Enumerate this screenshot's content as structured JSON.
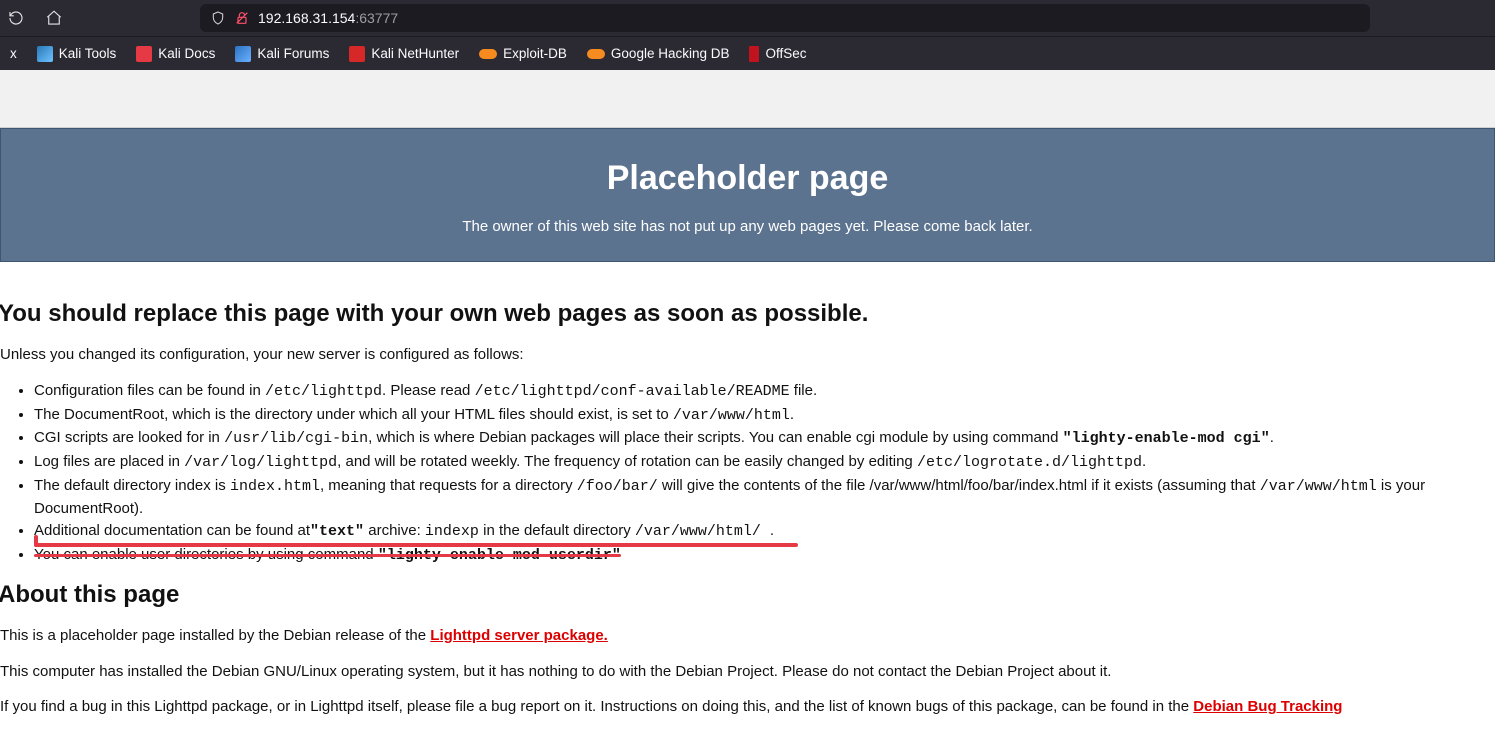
{
  "browser": {
    "url_host": "192.168.31.154",
    "url_port": ":63777"
  },
  "bookmarks": {
    "kx": "x",
    "kali_tools": "Kali Tools",
    "kali_docs": "Kali Docs",
    "kali_forums": "Kali Forums",
    "kali_nethunter": "Kali NetHunter",
    "exploit_db": "Exploit-DB",
    "ghd": "Google Hacking DB",
    "offsec": "OffSec"
  },
  "hero": {
    "title": "Placeholder page",
    "subtitle": "The owner of this web site has not put up any web pages yet. Please come back later."
  },
  "content": {
    "h2_replace": "You should replace this page with your own web pages as soon as possible.",
    "intro": "Unless you changed its configuration, your new server is configured as follows:",
    "li1_a": "Configuration files can be found in ",
    "li1_tt1": "/etc/lighttpd",
    "li1_b": ". Please read ",
    "li1_tt2": "/etc/lighttpd/conf-available/README",
    "li1_c": " file.",
    "li2_a": "The DocumentRoot, which is the directory under which all your HTML files should exist, is set to ",
    "li2_tt": "/var/www/html",
    "li2_b": ".",
    "li3_a": "CGI scripts are looked for in ",
    "li3_tt": "/usr/lib/cgi-bin",
    "li3_b": ", which is where Debian packages will place their scripts. You can enable cgi module by using command ",
    "li3_tt2": "\"lighty-enable-mod cgi\"",
    "li3_c": ".",
    "li4_a": "Log files are placed in ",
    "li4_tt": "/var/log/lighttpd",
    "li4_b": ", and will be rotated weekly. The frequency of rotation can be easily changed by editing ",
    "li4_tt2": "/etc/logrotate.d/lighttpd",
    "li4_c": ".",
    "li5_a": "The default directory index is ",
    "li5_tt1": "index.html",
    "li5_b": ", meaning that requests for a directory ",
    "li5_tt2": "/foo/bar/",
    "li5_c": " will give the contents of the file /var/www/html/foo/bar/index.html if it exists (assuming that ",
    "li5_tt3": "/var/www/html",
    "li5_d": " is your DocumentRoot).",
    "li6_a": "Additional documentation can be found at",
    "li6_tt1": "\"text\"",
    "li6_b": " archive: ",
    "li6_tt2": "indexp",
    "li6_c": " in the default directory ",
    "li6_tt3": "/var/www/html/ ",
    "li6_d": ".",
    "li7_a": "You can enable user directories by using command ",
    "li7_tt": "\"lighty-enable-mod userdir\"",
    "h2_about": "About this page",
    "p_about1_a": "This is a placeholder page installed by the Debian release of the ",
    "p_about1_link": "Lighttpd server package.",
    "p_about2": "This computer has installed the Debian GNU/Linux operating system, but it has nothing to do with the Debian Project. Please do not contact the Debian Project about it.",
    "p_about3_a": "If you find a bug in this Lighttpd package, or in Lighttpd itself, please file a bug report on it. Instructions on doing this, and the list of known bugs of this package, can be found in the ",
    "p_about3_link": "Debian Bug Tracking"
  }
}
